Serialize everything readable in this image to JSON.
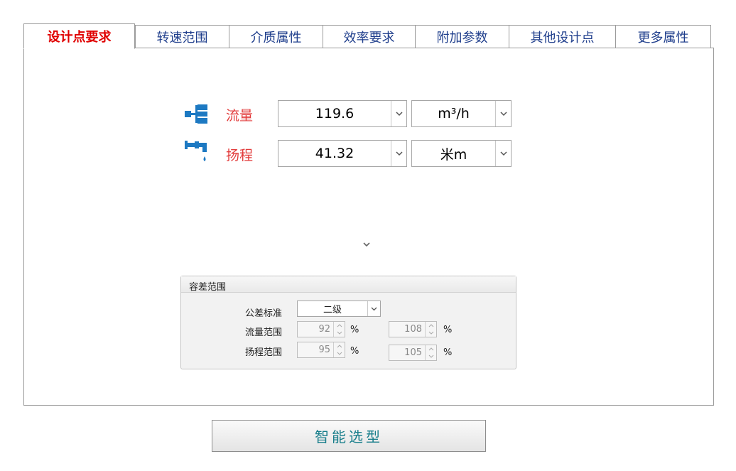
{
  "tabs": [
    {
      "label": "设计点要求"
    },
    {
      "label": "转速范围"
    },
    {
      "label": "介质属性"
    },
    {
      "label": "效率要求"
    },
    {
      "label": "附加参数"
    },
    {
      "label": "其他设计点"
    },
    {
      "label": "更多属性"
    }
  ],
  "active_tab": "设计点要求",
  "design_point": {
    "flow": {
      "label": "流量",
      "icon": "flow-branch-icon",
      "value": "119.6",
      "unit": "m³/h"
    },
    "head": {
      "label": "扬程",
      "icon": "faucet-icon",
      "value": "41.32",
      "unit": "米m"
    }
  },
  "tolerance": {
    "title": "容差范围",
    "standard_label": "公差标准",
    "standard_value": "二级",
    "flow_range_label": "流量范围",
    "flow_min": "92",
    "flow_max": "108",
    "head_range_label": "扬程范围",
    "head_min": "95",
    "head_max": "105",
    "percent": "%"
  },
  "actions": {
    "smart_select_label": "智能选型"
  },
  "colors": {
    "accent_red": "#e23b3b",
    "tab_text": "#1f3e8c",
    "icon_blue": "#1d79c2",
    "button_text": "#167d8a"
  }
}
